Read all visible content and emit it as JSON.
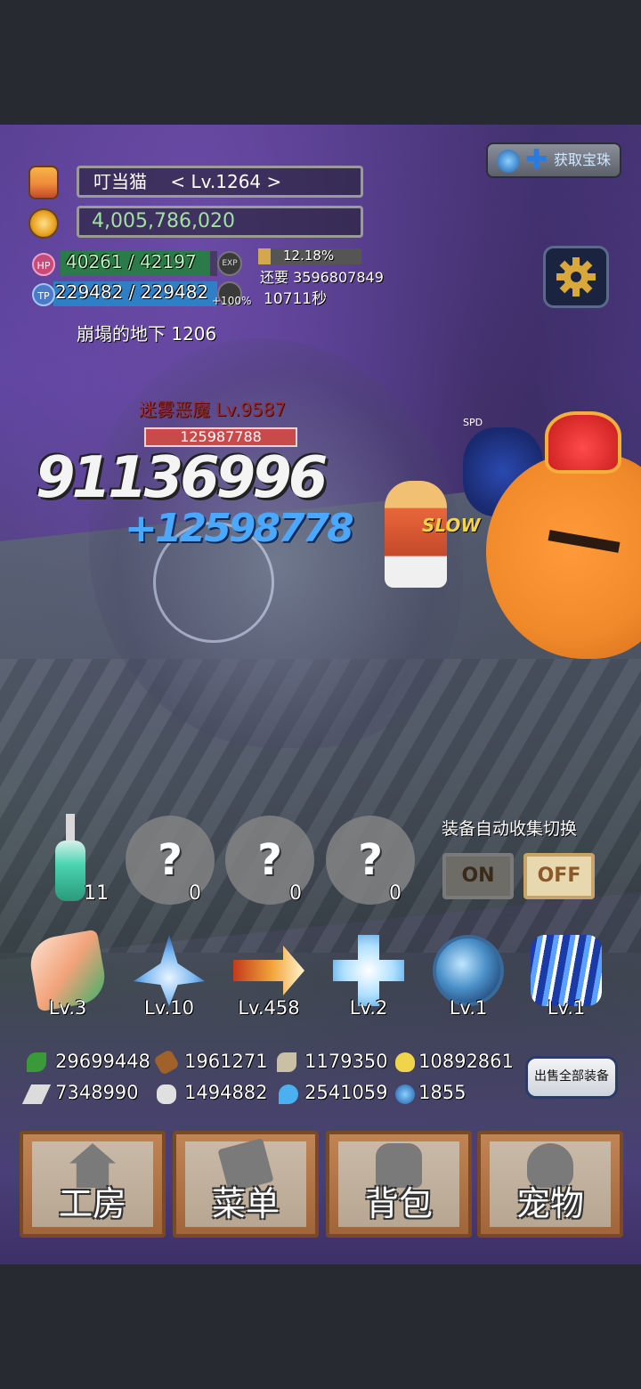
{
  "player": {
    "name": "叮当猫",
    "level": "< Lv.1264 >",
    "gold": "4,005,786,020",
    "hp_label": "HP",
    "hp": "40261 / 42197",
    "hp_fraction": 0.954,
    "tp_label": "TP",
    "tp": "229482 / 229482",
    "tp_fraction": 1.0,
    "exp_badge": "EXP",
    "exp_bonus": "+100%",
    "exp_percent": "12.18%",
    "exp_fraction": 0.1218,
    "exp_remaining": "还要 3596807849",
    "time_remaining": "10711秒",
    "location": "崩塌的地下 1206"
  },
  "top_button": {
    "label": "获取宝珠"
  },
  "enemy": {
    "name": "迷雾恶魔 Lv.9587",
    "hp": "125987788",
    "damage_main": "91136996",
    "damage_secondary": "+12598778",
    "status": "SLOW",
    "spd": "SPD"
  },
  "auto_collect": {
    "label": "装备自动收集切换",
    "on": "ON",
    "off": "OFF"
  },
  "items": {
    "potion_count": "11",
    "slots": [
      {
        "symbol": "?",
        "count": "0"
      },
      {
        "symbol": "?",
        "count": "0"
      },
      {
        "symbol": "?",
        "count": "0"
      }
    ]
  },
  "skills": [
    {
      "name": "feather-skill",
      "level": "Lv.3",
      "color": "#f2a37a"
    },
    {
      "name": "ice-sword-skill",
      "level": "Lv.10",
      "color": "#7ab8f2"
    },
    {
      "name": "fire-arrow-skill",
      "level": "Lv.458",
      "color": "#f2a53a"
    },
    {
      "name": "holy-cross-skill",
      "level": "Lv.2",
      "color": "#aee0ff"
    },
    {
      "name": "orb-shield-skill",
      "level": "Lv.1",
      "color": "#4a90c8"
    },
    {
      "name": "lightning-skill",
      "level": "Lv.1",
      "color": "#3a7ae0"
    }
  ],
  "resources": {
    "row1": [
      "29699448",
      "1961271",
      "1179350",
      "10892861"
    ],
    "row2": [
      "7348990",
      "1494882",
      "2541059",
      "1855"
    ],
    "icons_row1": [
      "herb-icon",
      "wood-icon",
      "feather-icon",
      "seed-icon"
    ],
    "icons_row2": [
      "ingot-icon",
      "ore-icon",
      "flame-icon",
      "gem-icon"
    ]
  },
  "sell_button": "出售全部装备",
  "bottom_menu": [
    {
      "label": "工房",
      "icon": "house-icon"
    },
    {
      "label": "菜单",
      "icon": "book-icon"
    },
    {
      "label": "背包",
      "icon": "backpack-icon"
    },
    {
      "label": "宠物",
      "icon": "pet-icon"
    }
  ]
}
